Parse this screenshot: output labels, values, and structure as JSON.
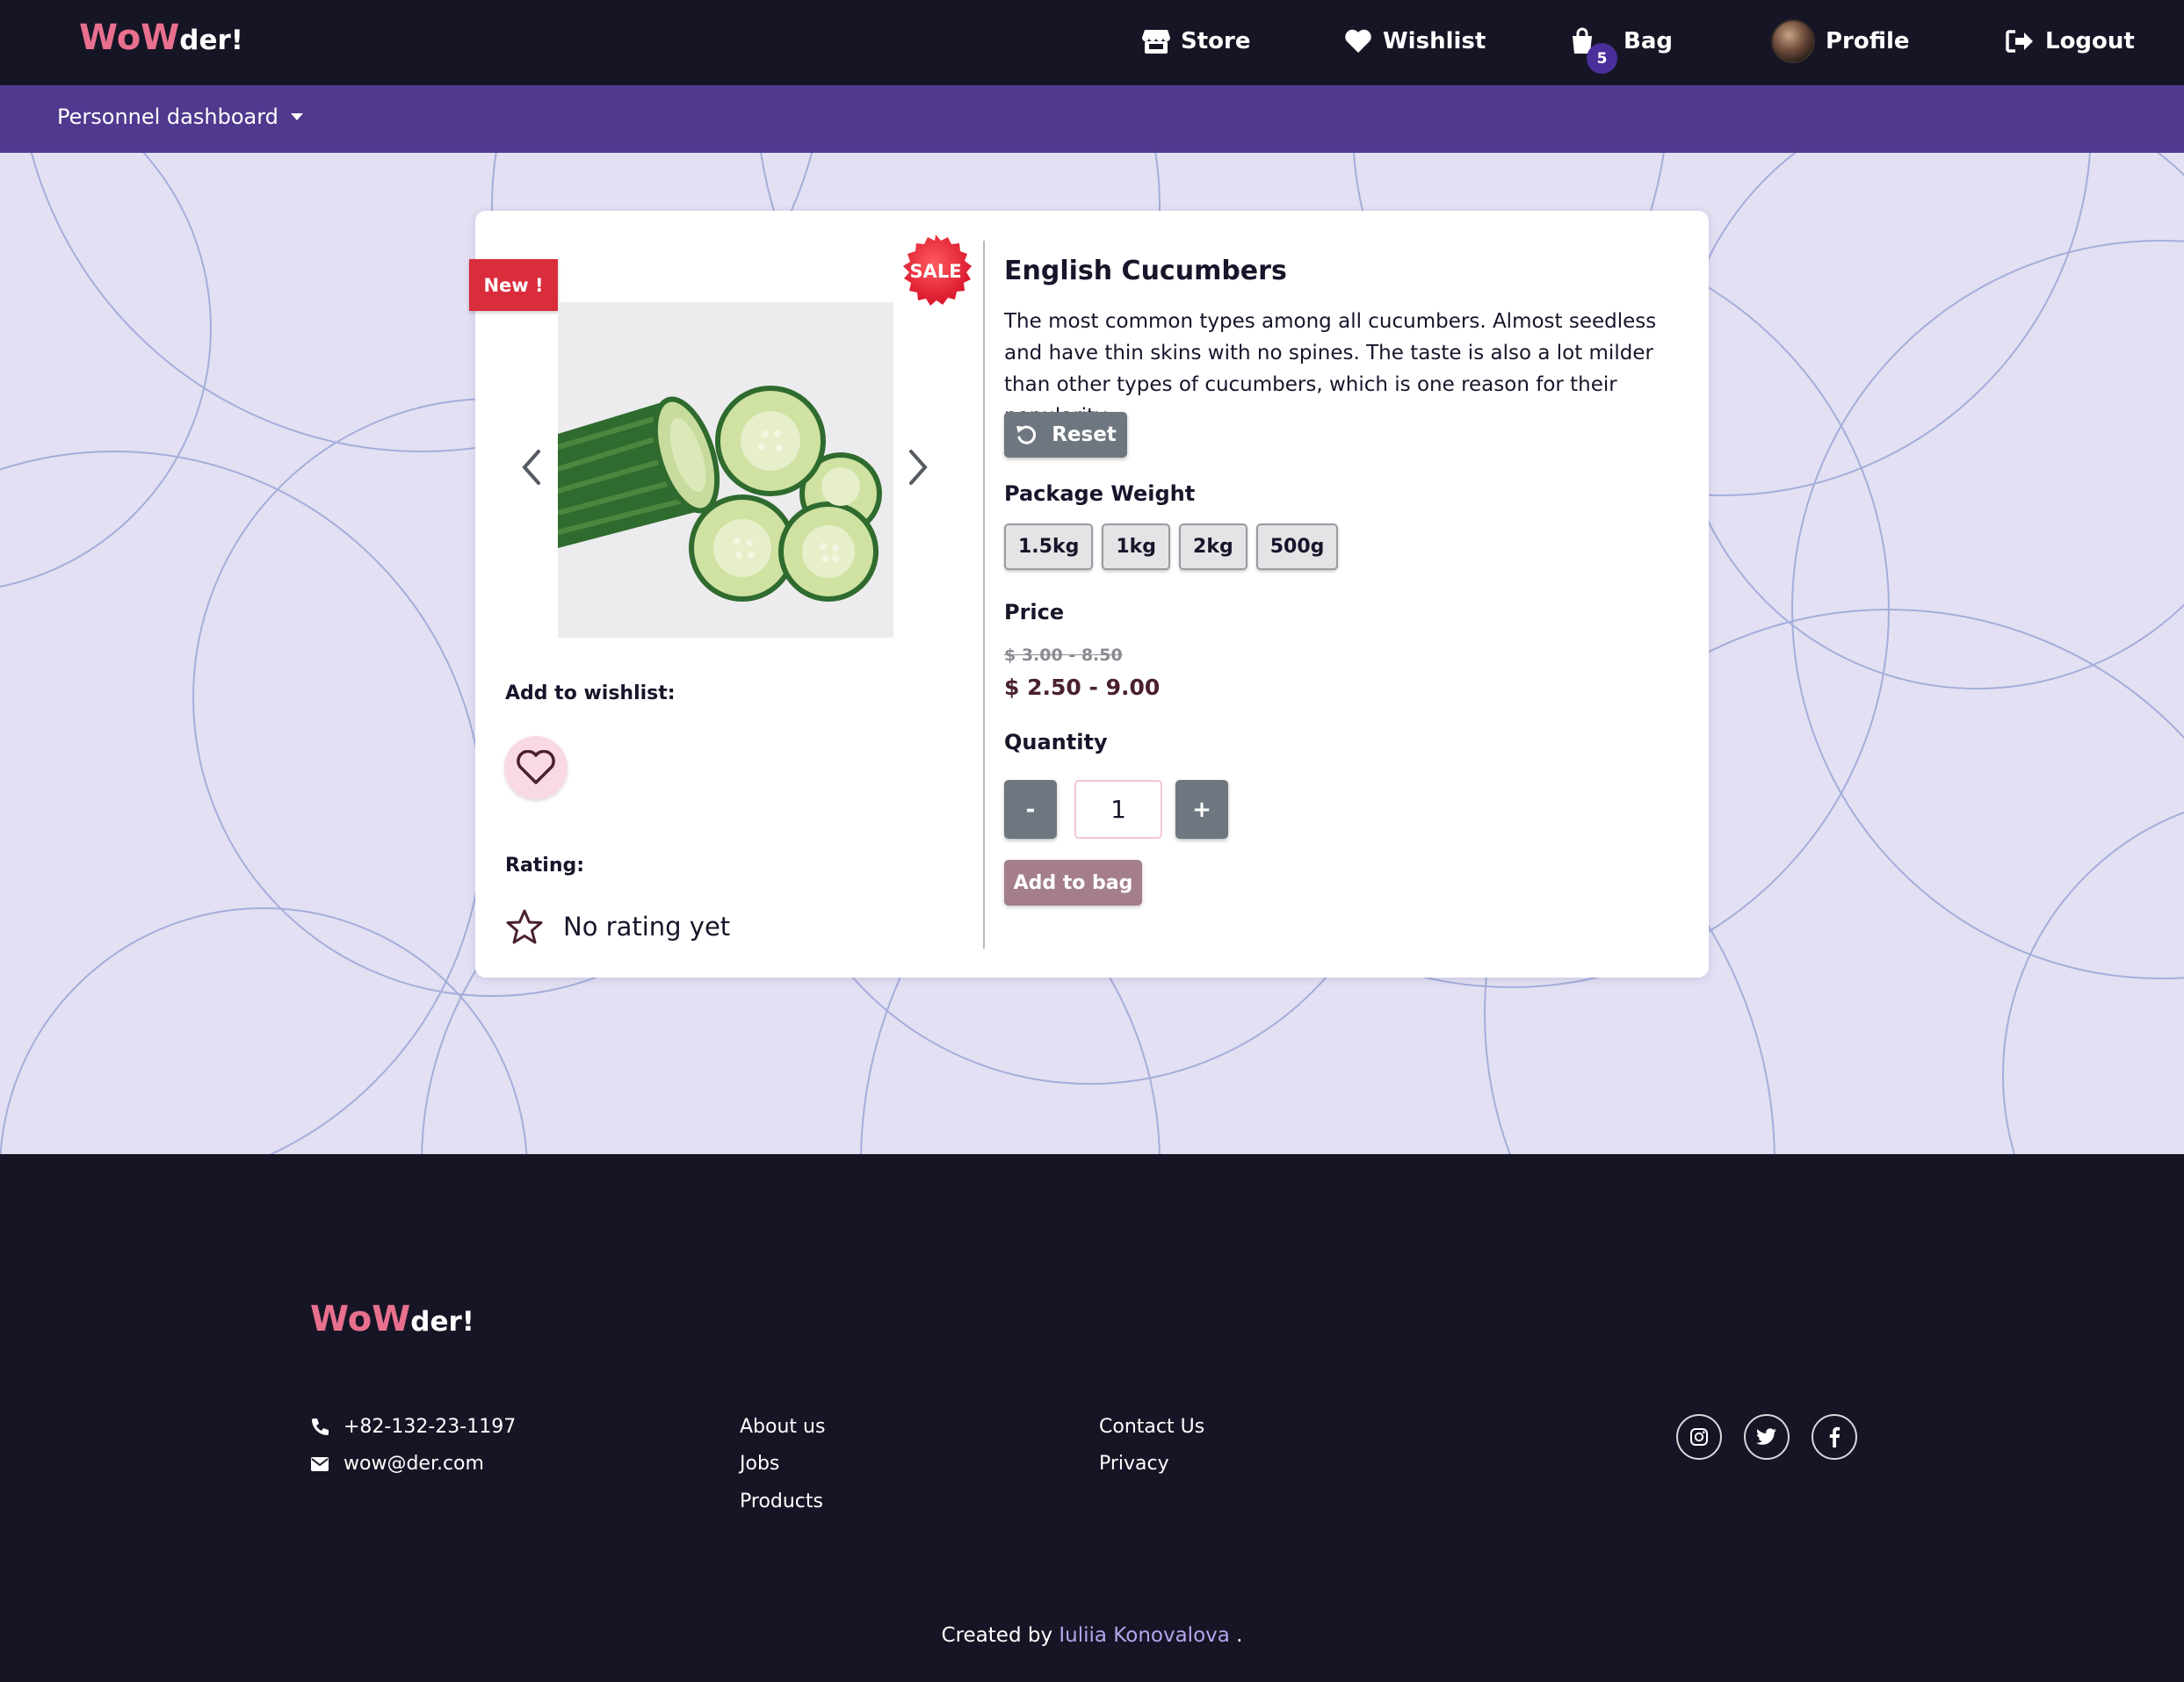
{
  "nav": {
    "brand_part1": "WoW",
    "brand_part2": "der!",
    "store": "Store",
    "wishlist": "Wishlist",
    "bag": "Bag",
    "bag_count": "5",
    "profile": "Profile",
    "logout": "Logout"
  },
  "subnav": {
    "dashboard": "Personnel dashboard"
  },
  "product": {
    "badge_new": "New !",
    "badge_sale": "SALE",
    "title": "English Cucumbers",
    "description": "The most common types among all cucumbers. Almost seedless and have thin skins with no spines. The taste is also a lot milder than other types of cucumbers, which is one reason for their popularity.",
    "reset_label": "Reset",
    "package_weight_label": "Package Weight",
    "weights": [
      "1.5kg",
      "1kg",
      "2kg",
      "500g"
    ],
    "price_label": "Price",
    "old_price": "$ 3.00 - 8.50",
    "new_price": "$ 2.50 - 9.00",
    "quantity_label": "Quantity",
    "quantity_minus": "-",
    "quantity_value": "1",
    "quantity_plus": "+",
    "add_to_bag": "Add to bag",
    "wishlist_label": "Add to wishlist:",
    "rating_label": "Rating:",
    "rating_text": "No rating yet"
  },
  "footer": {
    "brand_part1": "WoW",
    "brand_part2": "der!",
    "phone": "+82-132-23-1197",
    "email": "wow@der.com",
    "links_col1": [
      "About us",
      "Jobs",
      "Products"
    ],
    "links_col2": [
      "Contact Us",
      "Privacy"
    ],
    "social": [
      "instagram-icon",
      "twitter-icon",
      "facebook-icon"
    ],
    "credit_prefix": "Created by",
    "credit_author": "Iuliia Konovalova",
    "credit_suffix": "."
  },
  "colors": {
    "nav_bg": "#161525",
    "subnav_bg": "#50398f",
    "page_bg": "#e3e0f3",
    "brand_pink": "#e8708e",
    "new_badge": "#d92d3c",
    "button_gray": "#6e7780",
    "add_bag": "#a47f8b"
  }
}
